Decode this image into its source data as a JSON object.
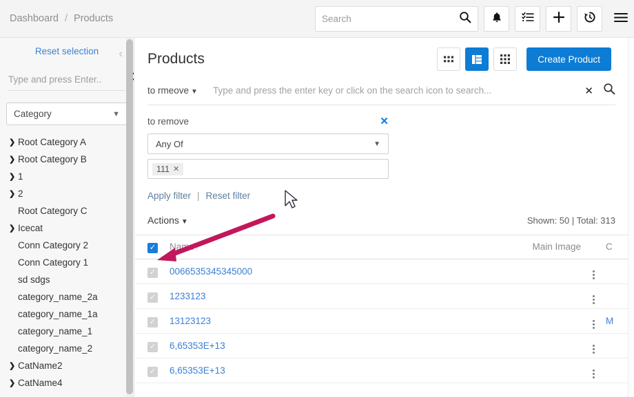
{
  "topbar": {
    "breadcrumb": [
      "Dashboard",
      "Products"
    ],
    "separator": "/",
    "search_placeholder": "Search",
    "search_value": "",
    "icons": [
      "search-icon",
      "bell-icon",
      "checklist-icon",
      "plus-icon",
      "history-icon",
      "hamburger-icon"
    ]
  },
  "sidebar": {
    "reset_label": "Reset selection",
    "collapse_icon": "chevron-left-icon",
    "search_placeholder": "Type and press Enter..",
    "search_value": "",
    "select_label": "Category",
    "tree": [
      {
        "label": "Root Category A",
        "expandable": true
      },
      {
        "label": "Root Category B",
        "expandable": true
      },
      {
        "label": "1",
        "expandable": true
      },
      {
        "label": "2",
        "expandable": true
      },
      {
        "label": "Root Category C",
        "expandable": false
      },
      {
        "label": "Icecat",
        "expandable": true
      },
      {
        "label": "Conn Category 2",
        "expandable": false
      },
      {
        "label": "Conn Category 1",
        "expandable": false
      },
      {
        "label": "sd sdgs",
        "expandable": false
      },
      {
        "label": "category_name_2a",
        "expandable": false
      },
      {
        "label": "category_name_1a",
        "expandable": false
      },
      {
        "label": "category_name_1",
        "expandable": false
      },
      {
        "label": "category_name_2",
        "expandable": false
      },
      {
        "label": "CatName2",
        "expandable": true
      },
      {
        "label": "CatName4",
        "expandable": true
      }
    ]
  },
  "main": {
    "title": "Products",
    "view_modes": [
      {
        "name": "grid-small-view",
        "active": false
      },
      {
        "name": "table-view",
        "active": true
      },
      {
        "name": "grid-large-view",
        "active": false
      }
    ],
    "create_button": "Create Product",
    "search_bar": {
      "dropdown_label": "to rmeove",
      "placeholder": "Type and press the enter key or click on the search icon to search...",
      "value": "",
      "clear_icon": "close-icon",
      "search_icon": "search-icon"
    },
    "filter_panel": {
      "title": "to remove",
      "close_icon": "close-icon",
      "operator": "Any Of",
      "tags": [
        "111"
      ]
    },
    "filter_links": {
      "apply": "Apply filter",
      "separator": "|",
      "reset": "Reset filter"
    },
    "actions_label": "Actions",
    "counts": "Shown: 50  |  Total: 313",
    "table": {
      "columns": [
        "Name",
        "Main Image",
        "C"
      ],
      "sort_column": "Name",
      "sort_direction": "ascending",
      "header_checkbox_checked": true,
      "rows": [
        {
          "name": "0066535345345000",
          "checked": true,
          "enabled": false,
          "extra": ""
        },
        {
          "name": "1233123",
          "checked": true,
          "enabled": false,
          "extra": ""
        },
        {
          "name": "13123123",
          "checked": true,
          "enabled": false,
          "extra": "M"
        },
        {
          "name": "6,65353E+13",
          "checked": true,
          "enabled": false,
          "extra": ""
        },
        {
          "name": "6,65353E+13",
          "checked": true,
          "enabled": false,
          "extra": ""
        }
      ]
    }
  },
  "annotation": {
    "arrow_color": "#c2185b",
    "points_to": "header-select-all-checkbox"
  },
  "colors": {
    "accent": "#0c7cd5",
    "link": "#3b7fd4",
    "sidebar_bg": "#f7f7f7",
    "topbar_bg": "#f4f4f4"
  }
}
